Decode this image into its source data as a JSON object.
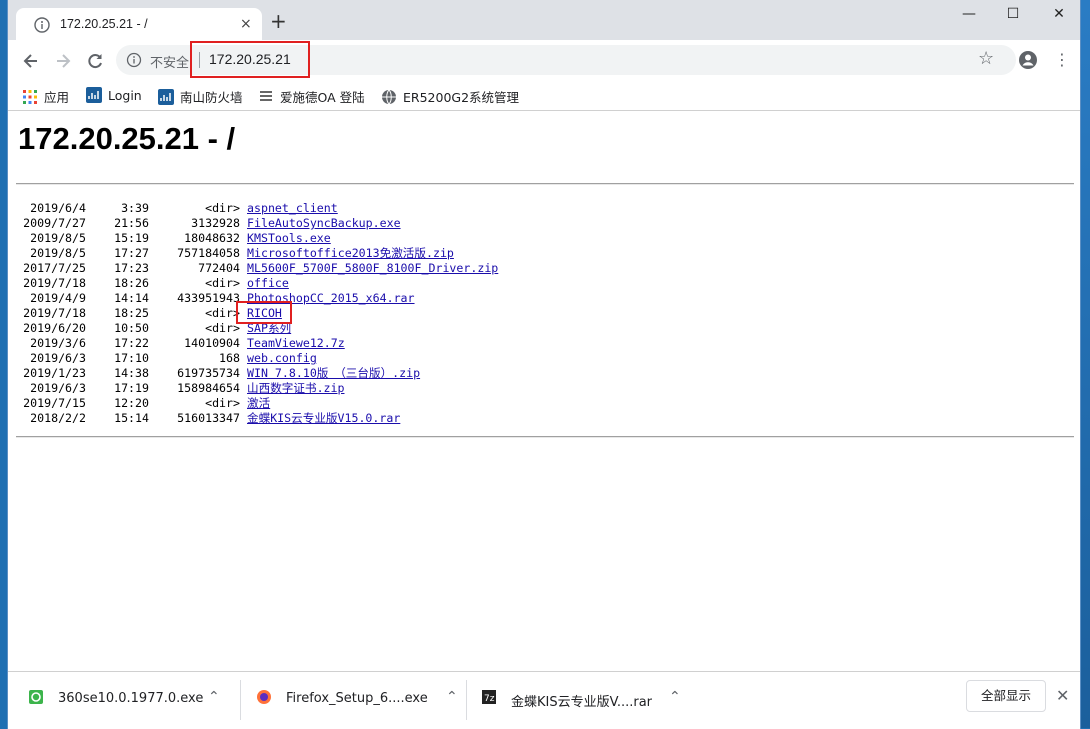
{
  "tab": {
    "title": "172.20.25.21 - /",
    "close": "×"
  },
  "newtab": "+",
  "window_controls": {
    "minimize": "—",
    "maximize": "☐",
    "close": "✕"
  },
  "omnibox": {
    "insecure_label": "不安全",
    "url": "172.20.25.21"
  },
  "bookmarks": [
    {
      "label": "应用"
    },
    {
      "label": "Login"
    },
    {
      "label": "南山防火墙"
    },
    {
      "label": "爱施德OA 登陆"
    },
    {
      "label": "ER5200G2系统管理"
    }
  ],
  "page": {
    "heading": "172.20.25.21 - /"
  },
  "listing": [
    {
      "date": "2019/6/4",
      "time": "3:39",
      "size": "<dir>",
      "name": "aspnet_client"
    },
    {
      "date": "2009/7/27",
      "time": "21:56",
      "size": "3132928",
      "name": "FileAutoSyncBackup.exe"
    },
    {
      "date": "2019/8/5",
      "time": "15:19",
      "size": "18048632",
      "name": "KMSTools.exe"
    },
    {
      "date": "2019/8/5",
      "time": "17:27",
      "size": "757184058",
      "name": "Microsoftoffice2013免激活版.zip"
    },
    {
      "date": "2017/7/25",
      "time": "17:23",
      "size": "772404",
      "name": "ML5600F_5700F_5800F_8100F_Driver.zip"
    },
    {
      "date": "2019/7/18",
      "time": "18:26",
      "size": "<dir>",
      "name": "office"
    },
    {
      "date": "2019/4/9",
      "time": "14:14",
      "size": "433951943",
      "name": "PhotoshopCC_2015_x64.rar"
    },
    {
      "date": "2019/7/18",
      "time": "18:25",
      "size": "<dir>",
      "name": "RICOH"
    },
    {
      "date": "2019/6/20",
      "time": "10:50",
      "size": "<dir>",
      "name": "SAP系列"
    },
    {
      "date": "2019/3/6",
      "time": "17:22",
      "size": "14010904",
      "name": "TeamViewe12.7z"
    },
    {
      "date": "2019/6/3",
      "time": "17:10",
      "size": "168",
      "name": "web.config"
    },
    {
      "date": "2019/1/23",
      "time": "14:38",
      "size": "619735734",
      "name": "WIN 7.8.10版　（三台版）.zip"
    },
    {
      "date": "2019/6/3",
      "time": "17:19",
      "size": "158984654",
      "name": "山西数字证书.zip"
    },
    {
      "date": "2019/7/15",
      "time": "12:20",
      "size": "<dir>",
      "name": "激活"
    },
    {
      "date": "2018/2/2",
      "time": "15:14",
      "size": "516013347",
      "name": "金蝶KIS云专业版V15.0.rar"
    }
  ],
  "downloads": [
    {
      "name": "360se10.0.1977.0.exe"
    },
    {
      "name": "Firefox_Setup_6....exe"
    },
    {
      "name": "金蝶KIS云专业版V....rar"
    }
  ],
  "show_all_label": "全部显示",
  "shelf_close": "✕",
  "colors": {
    "link": "#1a0dab",
    "highlight": "#e02020",
    "tabstrip": "#dee1e6"
  }
}
